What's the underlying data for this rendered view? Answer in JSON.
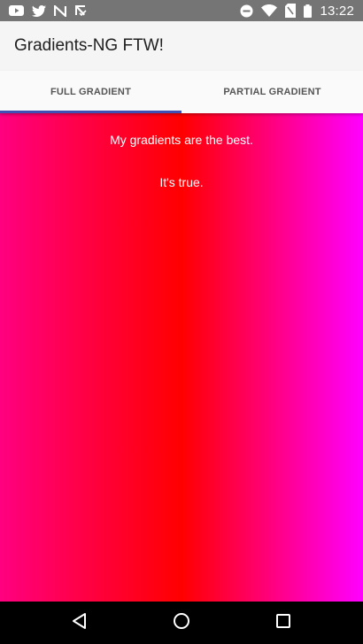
{
  "status_bar": {
    "time": "13:22",
    "left_icons": [
      "youtube-icon",
      "twitter-icon",
      "n-app-icon",
      "download-check-icon"
    ],
    "right_icons": [
      "do-not-disturb-icon",
      "wifi-icon",
      "no-sim-icon",
      "battery-icon"
    ]
  },
  "app_bar": {
    "title": "Gradients-NG FTW!"
  },
  "tabs": [
    {
      "label": "FULL GRADIENT",
      "active": true
    },
    {
      "label": "PARTIAL GRADIENT",
      "active": false
    }
  ],
  "content": {
    "line1": "My gradients are the best.",
    "line2": "It's true.",
    "gradient_colors": [
      "#ff0080",
      "#ff0000",
      "#ff00ff"
    ]
  },
  "nav_bar": {
    "buttons": [
      "back-icon",
      "home-icon",
      "recents-icon"
    ]
  },
  "colors": {
    "accent": "#3f51b5",
    "status_bar": "#757575",
    "app_bar": "#f5f5f5"
  }
}
